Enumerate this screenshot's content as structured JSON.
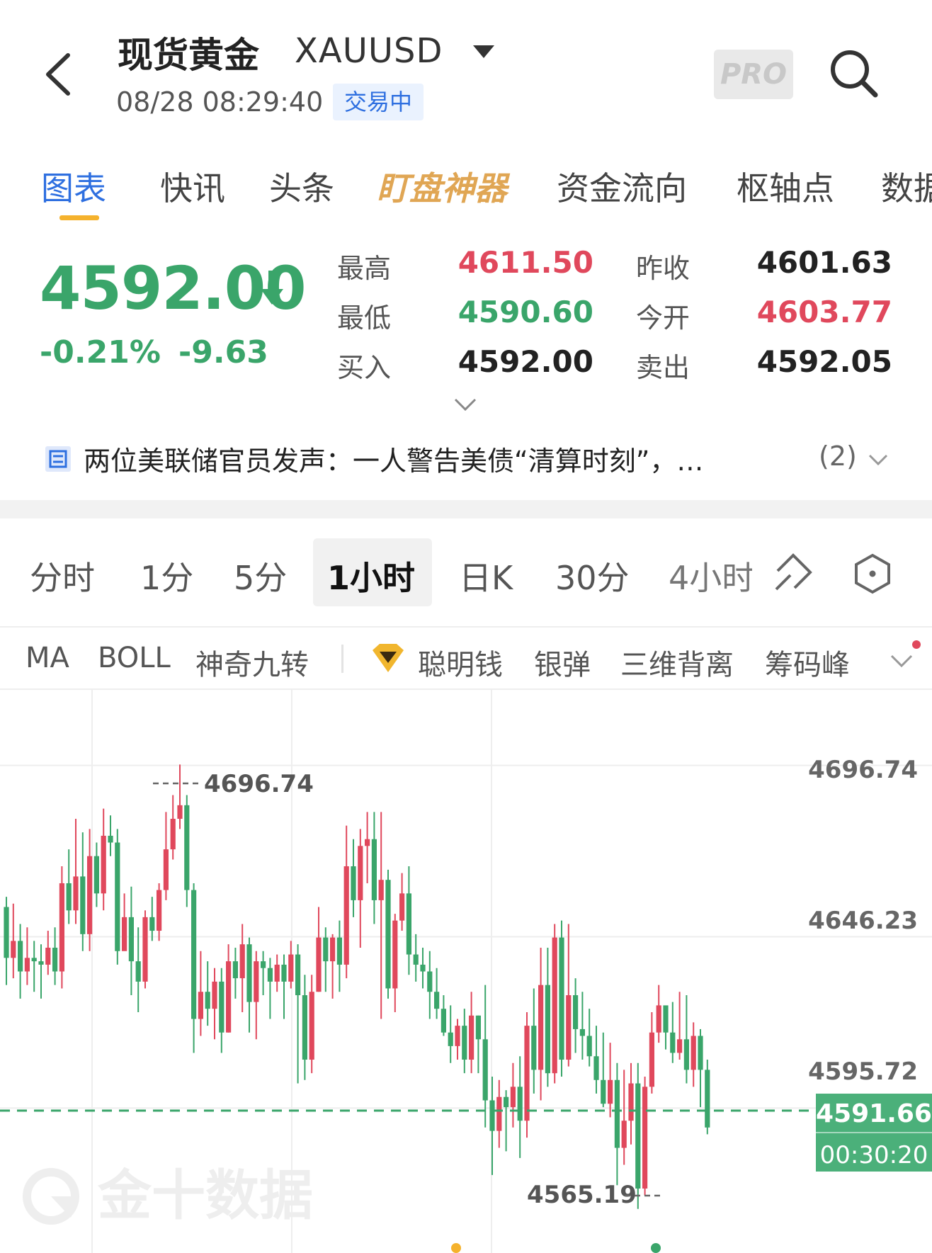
{
  "header": {
    "back_icon": "chevron-left-icon",
    "title": "现货黄金",
    "symbol": "XAUUSD",
    "timestamp": "08/28 08:29:40",
    "status": "交易中",
    "pro_label": "PRO",
    "search_icon": "search-icon"
  },
  "tabs": [
    {
      "label": "图表",
      "active": true
    },
    {
      "label": "快讯"
    },
    {
      "label": "头条"
    },
    {
      "label": "盯盘神器"
    },
    {
      "label": "资金流向"
    },
    {
      "label": "枢轴点"
    },
    {
      "label": "数据"
    }
  ],
  "quote": {
    "price": "4592.00",
    "change_pct": "-0.21%",
    "change": "-9.63",
    "high_label": "最高",
    "high": "4611.50",
    "prev_close_label": "昨收",
    "prev_close": "4601.63",
    "low_label": "最低",
    "low": "4590.60",
    "open_label": "今开",
    "open": "4603.77",
    "bid_label": "买入",
    "bid": "4592.00",
    "ask_label": "卖出",
    "ask": "4592.05",
    "colors": {
      "up": "#e0485c",
      "down": "#3aa56a"
    }
  },
  "news": {
    "icon": "document-icon",
    "text": "两位美联储官员发声：一人警告美债“清算时刻”，…",
    "count": "(2)"
  },
  "intervals": {
    "items": [
      "分时",
      "1分",
      "5分",
      "1小时",
      "日K",
      "30分",
      "4小时"
    ],
    "active": "1小时",
    "draw_icon": "drawing-pen-icon",
    "settings_icon": "hexagon-settings-icon"
  },
  "indicators": {
    "items": [
      "MA",
      "BOLL",
      "神奇九转",
      "聪明钱",
      "银弹",
      "三维背离",
      "筹码峰"
    ],
    "gem_icon": "diamond-icon"
  },
  "chart_data": {
    "type": "candlestick",
    "y_ticks": [
      "4696.74",
      "4646.23",
      "4595.72"
    ],
    "ylim": [
      4553,
      4719
    ],
    "max_label": "4696.74",
    "min_label": "4565.19",
    "current_price": "4591.66",
    "countdown": "00:30:20",
    "watermark": "金十数据",
    "colors": {
      "up": "#e0485c",
      "down": "#3aa56a",
      "grid": "#eeeeee"
    },
    "candles": [
      [
        4655,
        4640,
        4658,
        4632
      ],
      [
        4640,
        4645,
        4656,
        4634
      ],
      [
        4645,
        4636,
        4650,
        4628
      ],
      [
        4636,
        4640,
        4649,
        4632
      ],
      [
        4640,
        4639,
        4645,
        4630
      ],
      [
        4639,
        4638,
        4644,
        4628
      ],
      [
        4638,
        4643,
        4648,
        4635
      ],
      [
        4643,
        4636,
        4649,
        4632
      ],
      [
        4636,
        4662,
        4667,
        4631
      ],
      [
        4662,
        4654,
        4672,
        4650
      ],
      [
        4654,
        4664,
        4681,
        4650
      ],
      [
        4664,
        4647,
        4677,
        4642
      ],
      [
        4647,
        4670,
        4678,
        4642
      ],
      [
        4670,
        4659,
        4674,
        4655
      ],
      [
        4659,
        4676,
        4684,
        4654
      ],
      [
        4676,
        4674,
        4682,
        4670
      ],
      [
        4674,
        4642,
        4678,
        4638
      ],
      [
        4642,
        4652,
        4659,
        4644
      ],
      [
        4652,
        4639,
        4661,
        4629
      ],
      [
        4639,
        4633,
        4649,
        4624
      ],
      [
        4633,
        4652,
        4654,
        4631
      ],
      [
        4652,
        4648,
        4658,
        4645
      ],
      [
        4648,
        4660,
        4662,
        4645
      ],
      [
        4660,
        4672,
        4683,
        4657
      ],
      [
        4672,
        4681,
        4688,
        4669
      ],
      [
        4681,
        4685,
        4697,
        4678
      ],
      [
        4685,
        4660,
        4688,
        4655
      ],
      [
        4660,
        4622,
        4662,
        4612
      ],
      [
        4622,
        4630,
        4642,
        4617
      ],
      [
        4630,
        4625,
        4639,
        4620
      ],
      [
        4625,
        4633,
        4637,
        4616
      ],
      [
        4633,
        4618,
        4637,
        4612
      ],
      [
        4618,
        4639,
        4644,
        4618
      ],
      [
        4639,
        4634,
        4643,
        4628
      ],
      [
        4634,
        4644,
        4650,
        4624
      ],
      [
        4644,
        4627,
        4646,
        4618
      ],
      [
        4627,
        4639,
        4642,
        4616
      ],
      [
        4639,
        4637,
        4642,
        4629
      ],
      [
        4637,
        4633,
        4640,
        4622
      ],
      [
        4633,
        4638,
        4641,
        4630
      ],
      [
        4638,
        4633,
        4641,
        4622
      ],
      [
        4633,
        4641,
        4645,
        4631
      ],
      [
        4641,
        4629,
        4644,
        4603
      ],
      [
        4629,
        4610,
        4635,
        4604
      ],
      [
        4610,
        4630,
        4635,
        4606
      ],
      [
        4630,
        4646,
        4655,
        4630
      ],
      [
        4646,
        4639,
        4649,
        4630
      ],
      [
        4639,
        4646,
        4647,
        4628
      ],
      [
        4646,
        4638,
        4651,
        4630
      ],
      [
        4638,
        4667,
        4679,
        4634
      ],
      [
        4667,
        4657,
        4675,
        4652
      ],
      [
        4657,
        4673,
        4678,
        4643
      ],
      [
        4673,
        4675,
        4683,
        4662
      ],
      [
        4675,
        4657,
        4683,
        4650
      ],
      [
        4657,
        4663,
        4683,
        4622
      ],
      [
        4663,
        4631,
        4666,
        4628
      ],
      [
        4631,
        4651,
        4653,
        4624
      ],
      [
        4651,
        4659,
        4665,
        4648
      ],
      [
        4659,
        4641,
        4667,
        4635
      ],
      [
        4641,
        4638,
        4647,
        4633
      ],
      [
        4638,
        4636,
        4643,
        4631
      ],
      [
        4636,
        4630,
        4642,
        4622
      ],
      [
        4630,
        4625,
        4637,
        4622
      ],
      [
        4625,
        4618,
        4629,
        4617
      ],
      [
        4618,
        4614,
        4626,
        4609
      ],
      [
        4614,
        4620,
        4622,
        4610
      ],
      [
        4620,
        4610,
        4625,
        4606
      ],
      [
        4610,
        4623,
        4630,
        4606
      ],
      [
        4623,
        4616,
        4623,
        4606
      ],
      [
        4616,
        4598,
        4632,
        4590
      ],
      [
        4598,
        4589,
        4605,
        4576
      ],
      [
        4589,
        4599,
        4604,
        4584
      ],
      [
        4599,
        4596,
        4601,
        4583
      ],
      [
        4596,
        4602,
        4609,
        4590
      ],
      [
        4602,
        4592,
        4611,
        4581
      ],
      [
        4592,
        4620,
        4624,
        4587
      ],
      [
        4620,
        4607,
        4631,
        4600
      ],
      [
        4607,
        4632,
        4643,
        4598
      ],
      [
        4632,
        4606,
        4643,
        4602
      ],
      [
        4606,
        4646,
        4650,
        4603
      ],
      [
        4646,
        4610,
        4651,
        4605
      ],
      [
        4610,
        4629,
        4650,
        4608
      ],
      [
        4629,
        4619,
        4634,
        4612
      ],
      [
        4619,
        4617,
        4630,
        4610
      ],
      [
        4617,
        4611,
        4625,
        4608
      ],
      [
        4611,
        4604,
        4620,
        4600
      ],
      [
        4604,
        4597,
        4618,
        4596
      ],
      [
        4597,
        4604,
        4615,
        4593
      ],
      [
        4604,
        4584,
        4609,
        4573
      ],
      [
        4584,
        4592,
        4607,
        4579
      ],
      [
        4592,
        4603,
        4609,
        4585
      ],
      [
        4603,
        4572,
        4609,
        4566
      ],
      [
        4572,
        4602,
        4605,
        4570
      ],
      [
        4602,
        4618,
        4624,
        4600
      ],
      [
        4618,
        4626,
        4632,
        4615
      ],
      [
        4626,
        4618,
        4624,
        4613
      ],
      [
        4618,
        4612,
        4627,
        4609
      ],
      [
        4612,
        4616,
        4630,
        4610
      ],
      [
        4616,
        4607,
        4629,
        4603
      ],
      [
        4607,
        4617,
        4621,
        4602
      ],
      [
        4617,
        4607,
        4619,
        4596
      ],
      [
        4607,
        4590,
        4610,
        4588
      ]
    ]
  }
}
